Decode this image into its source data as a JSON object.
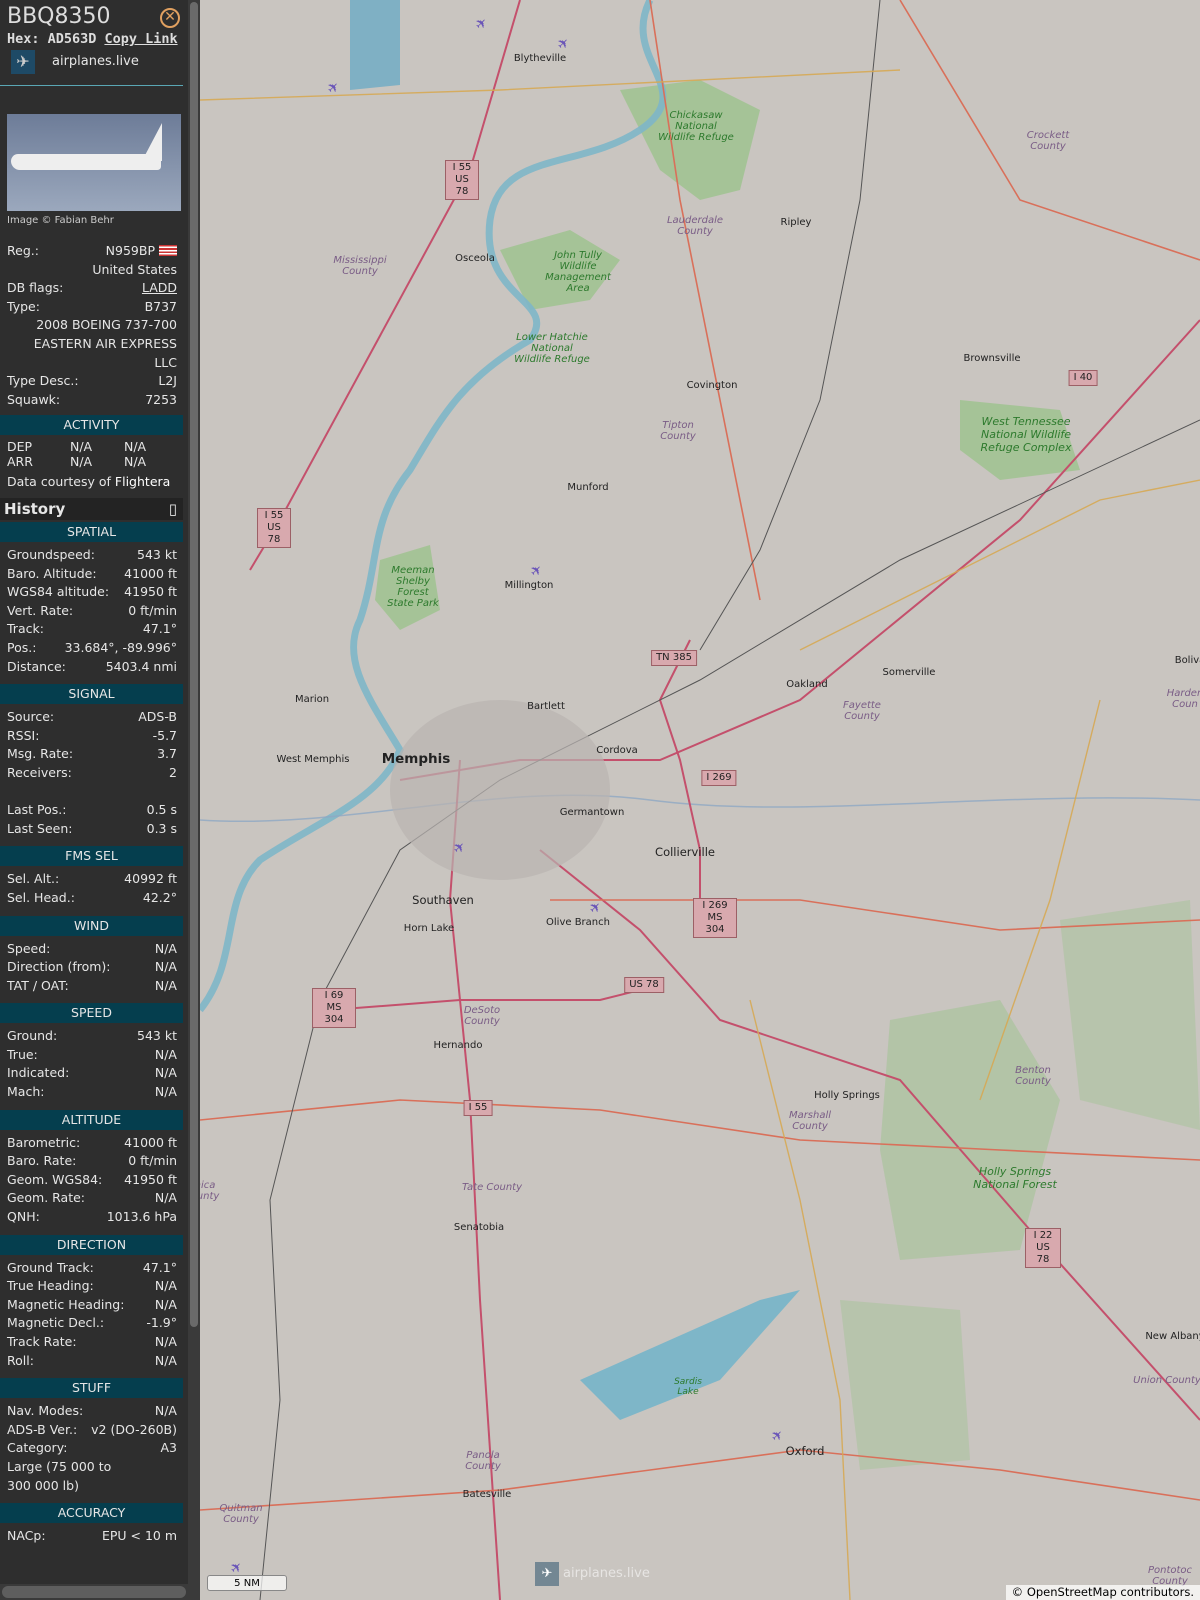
{
  "aircraft": {
    "callsign": "BBQ8350",
    "hex_label": "Hex:",
    "hex": "AD563D",
    "copy_link": "Copy Link",
    "site": "airplanes.live",
    "image_credit": "Image © Fabian Behr"
  },
  "info": [
    {
      "label": "Reg.:",
      "value": "N959BP"
    },
    {
      "label": "",
      "value": "United States"
    },
    {
      "label": "DB flags:",
      "value": "LADD"
    },
    {
      "label": "Type:",
      "value": "B737"
    },
    {
      "label": "",
      "value": "2008 BOEING 737-700"
    },
    {
      "label": "",
      "value": "EASTERN AIR EXPRESS"
    },
    {
      "label": "",
      "value": "LLC"
    },
    {
      "label": "Type Desc.:",
      "value": "L2J"
    },
    {
      "label": "Squawk:",
      "value": "7253"
    }
  ],
  "activity": {
    "title": "ACTIVITY",
    "dep": [
      "DEP",
      "N/A",
      "N/A"
    ],
    "arr": [
      "ARR",
      "N/A",
      "N/A"
    ],
    "courtesy": "Data courtesy of",
    "provider": "Flightera"
  },
  "history": {
    "title": "History",
    "icon": "square-icon"
  },
  "sections": [
    {
      "title": "SPATIAL",
      "rows": [
        [
          "Groundspeed:",
          "543 kt"
        ],
        [
          "Baro. Altitude:",
          "41000 ft"
        ],
        [
          "WGS84 altitude:",
          "41950 ft"
        ],
        [
          "Vert. Rate:",
          "0 ft/min"
        ],
        [
          "Track:",
          "47.1°"
        ],
        [
          "Pos.:",
          "33.684°, -89.996°"
        ],
        [
          "Distance:",
          "5403.4 nmi"
        ]
      ]
    },
    {
      "title": "SIGNAL",
      "rows": [
        [
          "Source:",
          "ADS-B"
        ],
        [
          "RSSI:",
          "-5.7"
        ],
        [
          "Msg. Rate:",
          "3.7"
        ],
        [
          "Receivers:",
          "2"
        ],
        [
          "",
          ""
        ],
        [
          "Last Pos.:",
          "0.5 s"
        ],
        [
          "Last Seen:",
          "0.3 s"
        ]
      ]
    },
    {
      "title": "FMS SEL",
      "rows": [
        [
          "Sel. Alt.:",
          "40992 ft"
        ],
        [
          "Sel. Head.:",
          "42.2°"
        ]
      ]
    },
    {
      "title": "WIND",
      "rows": [
        [
          "Speed:",
          "N/A"
        ],
        [
          "Direction (from):",
          "N/A"
        ],
        [
          "TAT / OAT:",
          "N/A"
        ]
      ]
    },
    {
      "title": "SPEED",
      "rows": [
        [
          "Ground:",
          "543 kt"
        ],
        [
          "True:",
          "N/A"
        ],
        [
          "Indicated:",
          "N/A"
        ],
        [
          "Mach:",
          "N/A"
        ]
      ]
    },
    {
      "title": "ALTITUDE",
      "rows": [
        [
          "Barometric:",
          "41000 ft"
        ],
        [
          "Baro. Rate:",
          "0 ft/min"
        ],
        [
          "Geom. WGS84:",
          "41950 ft"
        ],
        [
          "Geom. Rate:",
          "N/A"
        ],
        [
          "QNH:",
          "1013.6 hPa"
        ]
      ]
    },
    {
      "title": "DIRECTION",
      "rows": [
        [
          "Ground Track:",
          "47.1°"
        ],
        [
          "True Heading:",
          "N/A"
        ],
        [
          "Magnetic Heading:",
          "N/A"
        ],
        [
          "Magnetic Decl.:",
          "-1.9°"
        ],
        [
          "Track Rate:",
          "N/A"
        ],
        [
          "Roll:",
          "N/A"
        ]
      ]
    },
    {
      "title": "STUFF",
      "rows": [
        [
          "Nav. Modes:",
          "N/A"
        ],
        [
          "ADS-B Ver.:",
          "v2 (DO-260B)"
        ],
        [
          "Category:",
          "A3"
        ],
        [
          "Large (75 000 to",
          ""
        ],
        [
          "300 000 lb)",
          ""
        ]
      ]
    },
    {
      "title": "ACCURACY",
      "rows": [
        [
          "NACp:",
          "EPU < 10 m"
        ]
      ]
    }
  ],
  "map": {
    "cities": [
      "Blytheville",
      "Osceola",
      "Ripley",
      "Brownsville",
      "Covington",
      "Munford",
      "Millington",
      "Bartlett",
      "Memphis",
      "West Memphis",
      "Marion",
      "Cordova",
      "Germantown",
      "Collierville",
      "Southaven",
      "Horn Lake",
      "Olive Branch",
      "Hernando",
      "Oakland",
      "Somerville",
      "Holly Springs",
      "Senatobia",
      "Batesville",
      "Oxford",
      "New Albany",
      "Boliva"
    ],
    "counties": [
      "Crockett County",
      "Lauderdale County",
      "Mississippi County",
      "Tipton County",
      "Fayette County",
      "Harden Coun",
      "DeSoto County",
      "Marshall County",
      "Benton County",
      "Tate County",
      "Panola County",
      "Quitman County",
      "Union County",
      "Pontotoc County",
      "nica ounty"
    ],
    "parks": [
      "Chickasaw National Wildlife Refuge",
      "John Tully Wildlife Management Area",
      "Lower Hatchie National Wildlife Refuge",
      "Meeman Shelby Forest State Park",
      "West Tennessee National Wildlife Refuge Complex",
      "Holly Springs National Forest",
      "Sardis Lake"
    ],
    "shields": [
      "I 55 US 78",
      "I 55 US 78",
      "I 40",
      "TN 385",
      "I 269",
      "I 269 MS 304",
      "US 78",
      "I 69 MS 304",
      "I 55",
      "I 22 US 78"
    ],
    "scale": "5 NM",
    "attribution": "© OpenStreetMap contributors.",
    "watermark": "airplanes.live"
  }
}
